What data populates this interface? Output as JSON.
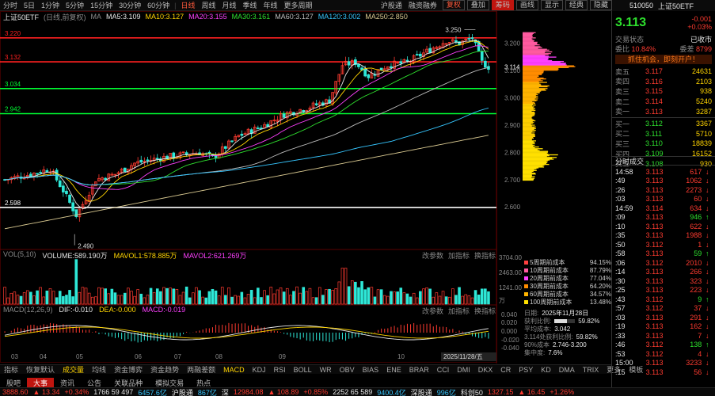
{
  "toolbar": {
    "periods": [
      "分时",
      "5日",
      "1分钟",
      "5分钟",
      "15分钟",
      "30分钟",
      "60分钟",
      "日线",
      "周线",
      "月线",
      "季线",
      "年线",
      "更多周期"
    ],
    "active_period": "日线",
    "security_title": "上证50ETF",
    "right_items": [
      "沪股通",
      "融资融券",
      "复权",
      "叠加"
    ],
    "buttons": [
      "筹码",
      "画线",
      "显示",
      "经典",
      "隐藏"
    ]
  },
  "indicators": {
    "name": "上证50ETF",
    "adjust": "(日线,前复权)",
    "ma_label": "MA",
    "ma5": "MA5:3.109",
    "ma10": "MA10:3.127",
    "ma20": "MA20:3.155",
    "ma30": "MA30:3.161",
    "ma60": "MA60:3.127",
    "ma120": "MA120:3.002",
    "ma250": "MA250:2.850"
  },
  "price_chart": {
    "h_lines": [
      {
        "label": "3.220",
        "value": 3.22,
        "color": "#ff2020"
      },
      {
        "label": "3.132",
        "value": 3.132,
        "color": "#ff2020"
      },
      {
        "label": "3.034",
        "value": 3.034,
        "color": "#00ff33"
      },
      {
        "label": "2.942",
        "value": 2.942,
        "color": "#00ff33"
      },
      {
        "label": "2.598",
        "value": 2.598,
        "color": "#ffffff"
      }
    ],
    "max_label": "3.250",
    "min_label": "2.490",
    "right_axis": [
      "3.200",
      "3.114",
      "3.100",
      "3.000",
      "2.900",
      "2.800",
      "2.700",
      "2.600"
    ],
    "last_price": 3.114
  },
  "volume": {
    "label": "VOL(5,10)",
    "volume": "VOLUME:589.190万",
    "mavol1": "MAVOL1:578.885万",
    "mavol2": "MAVOL2:621.269万",
    "axis": [
      "3704.00",
      "2463.00",
      "1241.00",
      "万"
    ],
    "links": [
      "改参数",
      "加指标",
      "换指标"
    ]
  },
  "macd": {
    "label": "MACD(12,26,9)",
    "dif": "DIF:-0.010",
    "dea": "DEA:-0.000",
    "macd": "MACD:-0.019",
    "axis": [
      "0.040",
      "0.020",
      "0.000",
      "-0.020",
      "-0.040"
    ],
    "links": [
      "改参数",
      "加指标",
      "换指标"
    ]
  },
  "xaxis": {
    "labels": [
      "03",
      "04",
      "05",
      "06",
      "07",
      "08",
      "09",
      "10"
    ],
    "last_date": "2025/11/28/五"
  },
  "chips_legend": {
    "rows": [
      {
        "label": "5周期前成本",
        "value": "94.15%",
        "color": "#ff4040"
      },
      {
        "label": "10周期前成本",
        "value": "87.79%",
        "color": "#ff5aa0"
      },
      {
        "label": "20周期前成本",
        "value": "77.04%",
        "color": "#ff40ff"
      },
      {
        "label": "30周期前成本",
        "value": "64.20%",
        "color": "#ff8c00"
      },
      {
        "label": "60周期前成本",
        "value": "34.57%",
        "color": "#ffb400"
      },
      {
        "label": "100周期前成本",
        "value": "13.48%",
        "color": "#ffe000"
      }
    ],
    "date_label": "日期:",
    "date": "2025年11月28日",
    "profit_label": "获利比例:",
    "profit": "59.82%",
    "profit_fraction": 0.5982,
    "avg_label": "平均成本:",
    "avg": "3.042",
    "profit_at": "3.114处获利比例:",
    "profit_at_val": "59.82%",
    "cost90_label": "90%成本",
    "cost90": "2.746-3.200",
    "conc90_label": "集中度:",
    "conc90": "7.6%"
  },
  "bottom_indicator_tabs": [
    "指标",
    "恢复默认",
    "成交量",
    "均线",
    "资金博弈",
    "资金趋势",
    "两融差额",
    "MACD",
    "KDJ",
    "RSI",
    "BOLL",
    "WR",
    "OBV",
    "BIAS",
    "ENE",
    "BRAR",
    "CCI",
    "DMI",
    "DKX",
    "CR",
    "PSY",
    "KD",
    "DMA",
    "TRIX",
    "更多",
    "模板"
  ],
  "quote_header": {
    "code": "510050",
    "name": "上证50ETF",
    "price": "3.113",
    "change": "-0.001",
    "change_pct": "+0.03%",
    "status_label": "交易状态",
    "status": "已收市",
    "webi_label": "委比",
    "webi": "10.84%",
    "weicha_label": "委差",
    "weicha": "8799",
    "promo": "抓住机会，即刻开户！"
  },
  "order_book": {
    "sell": [
      {
        "label": "卖五",
        "price": "3.117",
        "vol": "24631"
      },
      {
        "label": "卖四",
        "price": "3.116",
        "vol": "2103"
      },
      {
        "label": "卖三",
        "price": "3.115",
        "vol": "938"
      },
      {
        "label": "卖二",
        "price": "3.114",
        "vol": "5240"
      },
      {
        "label": "卖一",
        "price": "3.113",
        "vol": "3287"
      }
    ],
    "buy": [
      {
        "label": "买一",
        "price": "3.112",
        "vol": "3367"
      },
      {
        "label": "买二",
        "price": "3.111",
        "vol": "5710"
      },
      {
        "label": "买三",
        "price": "3.110",
        "vol": "18839"
      },
      {
        "label": "买四",
        "price": "3.109",
        "vol": "16152"
      },
      {
        "label": "买五",
        "price": "3.108",
        "vol": "930"
      }
    ]
  },
  "ticks_header": "分时成交",
  "ticks": [
    {
      "t": "14:58",
      "p": "3.113",
      "v": "617",
      "d": "S"
    },
    {
      "t": ":49",
      "p": "3.113",
      "v": "1062",
      "d": "S"
    },
    {
      "t": ":26",
      "p": "3.113",
      "v": "2273",
      "d": "S"
    },
    {
      "t": ":03",
      "p": "3.113",
      "v": "60",
      "d": "S"
    },
    {
      "t": "14:59",
      "p": "3.114",
      "v": "634",
      "d": "S"
    },
    {
      "t": ":09",
      "p": "3.113",
      "v": "946",
      "d": "B"
    },
    {
      "t": ":10",
      "p": "3.113",
      "v": "622",
      "d": "S"
    },
    {
      "t": ":35",
      "p": "3.113",
      "v": "1988",
      "d": "S"
    },
    {
      "t": ":50",
      "p": "3.112",
      "v": "1",
      "d": "S"
    },
    {
      "t": ":58",
      "p": "3.113",
      "v": "59",
      "d": "B"
    },
    {
      "t": ":06",
      "p": "3.112",
      "v": "2010",
      "d": "S"
    },
    {
      "t": ":14",
      "p": "3.113",
      "v": "266",
      "d": "S"
    },
    {
      "t": ":30",
      "p": "3.113",
      "v": "323",
      "d": "S"
    },
    {
      "t": ":25",
      "p": "3.113",
      "v": "223",
      "d": "S"
    },
    {
      "t": ":43",
      "p": "3.112",
      "v": "9",
      "d": "B"
    },
    {
      "t": ":57",
      "p": "3.112",
      "v": "37",
      "d": "S"
    },
    {
      "t": ":03",
      "p": "3.113",
      "v": "291",
      "d": "S"
    },
    {
      "t": ":19",
      "p": "3.113",
      "v": "162",
      "d": "S"
    },
    {
      "t": ":33",
      "p": "3.113",
      "v": "7",
      "d": "S"
    },
    {
      "t": ":46",
      "p": "3.112",
      "v": "138",
      "d": "B"
    },
    {
      "t": ":53",
      "p": "3.112",
      "v": "4",
      "d": "S"
    },
    {
      "t": "15:00",
      "p": "3.113",
      "v": "3233",
      "d": "S"
    },
    {
      "t": ":15",
      "p": "3.113",
      "v": "56",
      "d": "S"
    }
  ],
  "footer_tabs": [
    "股吧",
    "大事",
    "资讯",
    "公告",
    "关联品种",
    "模拟交易",
    "热点"
  ],
  "footer_active": "大事",
  "ticker": [
    {
      "name": "",
      "v": "3888.60",
      "c": "up"
    },
    {
      "name": "",
      "v": "▲ 13.34",
      "c": "up"
    },
    {
      "name": "",
      "v": "+0.34%",
      "c": "up"
    },
    {
      "name": "",
      "v": "1766 59 497",
      "c": "wh"
    },
    {
      "name": "",
      "v": "6457.6亿",
      "c": "cy"
    },
    {
      "name": "沪股通",
      "v": "867亿",
      "c": "cy"
    },
    {
      "name": "深",
      "v": "12984.08",
      "c": "up"
    },
    {
      "name": "",
      "v": "▲ 108.89",
      "c": "up"
    },
    {
      "name": "",
      "v": "+0.85%",
      "c": "up"
    },
    {
      "name": "",
      "v": "2252 65 589",
      "c": "wh"
    },
    {
      "name": "",
      "v": "9400.4亿",
      "c": "cy"
    },
    {
      "name": "深股通",
      "v": "996亿",
      "c": "cy"
    },
    {
      "name": "科创50",
      "v": "1327.15",
      "c": "up"
    },
    {
      "name": "",
      "v": "▲ 16.45",
      "c": "up"
    },
    {
      "name": "",
      "v": "+1.26%",
      "c": "up"
    }
  ]
}
